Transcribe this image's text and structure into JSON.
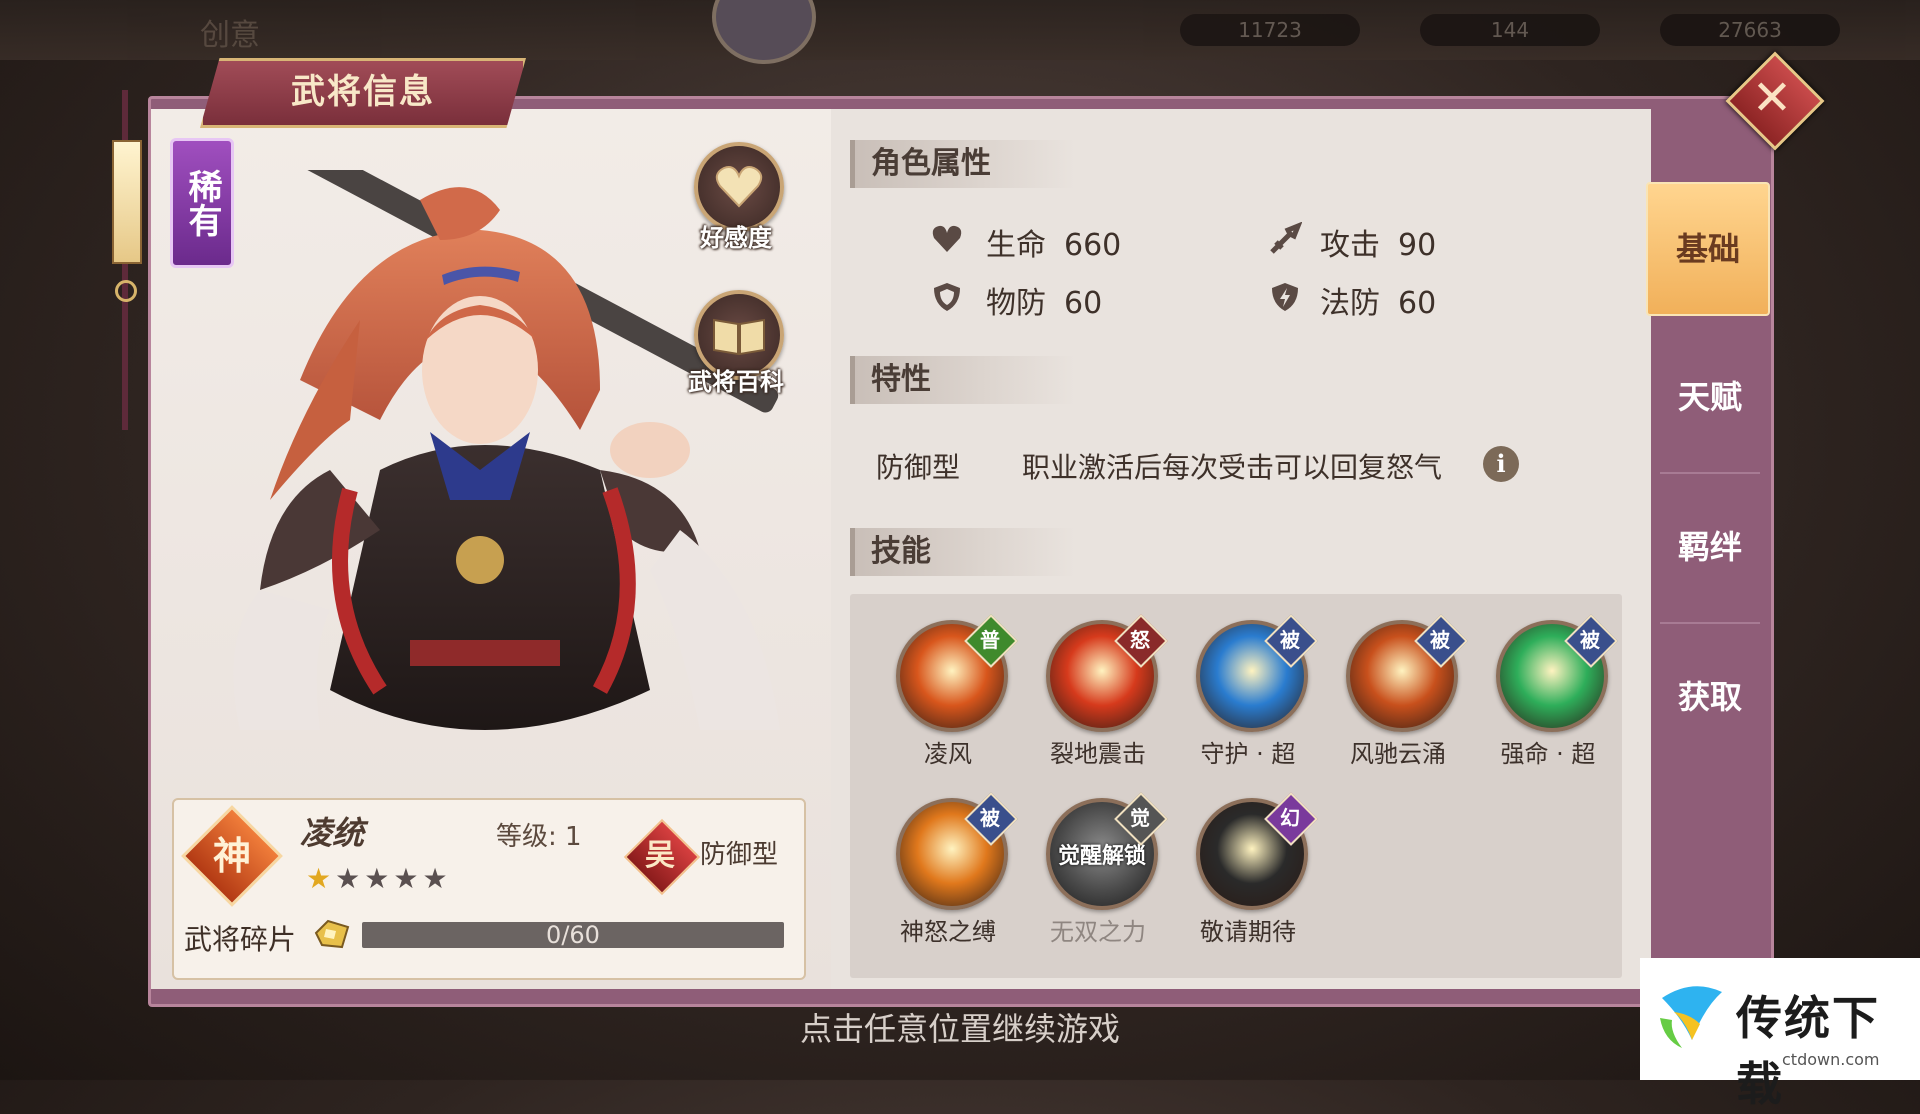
{
  "hud": {
    "title": "创意",
    "res1": "11723",
    "res2": "144",
    "res3": "27663"
  },
  "panel": {
    "title": "武将信息",
    "close_icon": "close-icon"
  },
  "hero": {
    "rarity": "稀有",
    "god_badge": "神",
    "name": "凌统",
    "level_label": "等级: 1",
    "stars_total": 5,
    "stars_filled": 1,
    "faction_badge": "吴",
    "class": "防御型",
    "shard_label": "武将碎片",
    "shard_progress": "0/60",
    "shard_current": 0,
    "shard_max": 60
  },
  "side_buttons": {
    "affinity": "好感度",
    "encyclopedia": "武将百科"
  },
  "attributes": {
    "header": "角色属性",
    "hp_label": "生命",
    "hp": "660",
    "atk_label": "攻击",
    "atk": "90",
    "pdef_label": "物防",
    "pdef": "60",
    "mdef_label": "法防",
    "mdef": "60"
  },
  "trait": {
    "header": "特性",
    "label": "防御型",
    "desc": "职业激活后每次受击可以回复怒气",
    "info_icon": "i"
  },
  "skills": {
    "header": "技能",
    "items": [
      {
        "name": "凌风",
        "tag": "普",
        "tag_color": "#3f8a2c",
        "color": "#d8561c"
      },
      {
        "name": "裂地震击",
        "tag": "怒",
        "tag_color": "#8a2a2a",
        "color": "#d63a1c"
      },
      {
        "name": "守护 · 超",
        "tag": "被",
        "tag_color": "#3a4f8c",
        "color": "#2a7ccf"
      },
      {
        "name": "风驰云涌",
        "tag": "被",
        "tag_color": "#3a4f8c",
        "color": "#c8501c"
      },
      {
        "name": "强命 · 超",
        "tag": "被",
        "tag_color": "#3a4f8c",
        "color": "#2eae5a"
      },
      {
        "name": "神怒之缚",
        "tag": "被",
        "tag_color": "#3a4f8c",
        "color": "#e0781c"
      },
      {
        "name": "无双之力",
        "tag": "觉",
        "tag_color": "#555555",
        "color": "#4a4a4a",
        "lock_text": "觉醒解锁"
      },
      {
        "name": "敬请期待",
        "tag": "幻",
        "tag_color": "#7a3a9c",
        "color": "#2a2a2a"
      }
    ]
  },
  "tabs": [
    "基础",
    "天赋",
    "羁绊",
    "获取"
  ],
  "bottom_tip": "点击任意位置继续游戏",
  "watermark": {
    "text": "传统下载",
    "sub": "ctdown.com"
  }
}
